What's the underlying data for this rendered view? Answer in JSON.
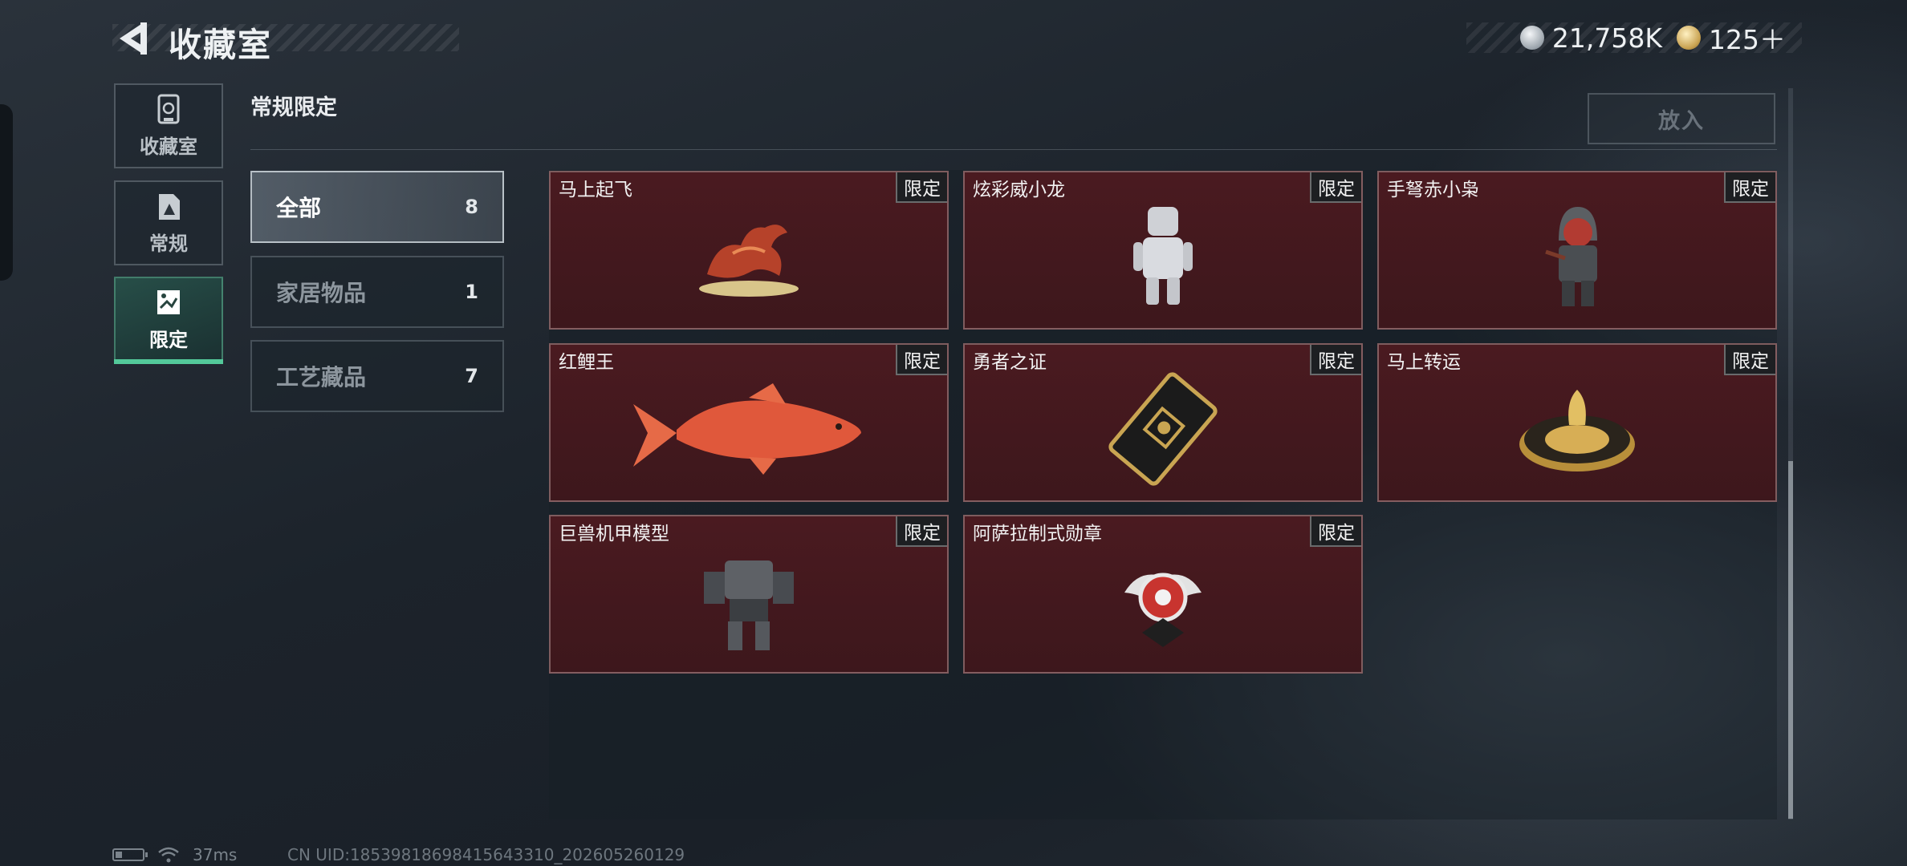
{
  "header": {
    "title": "收藏室",
    "currency_silver": "21,758K",
    "currency_gold": "125＋"
  },
  "sidebar": {
    "items": [
      {
        "label": "收藏室",
        "icon": "trophy-case-icon"
      },
      {
        "label": "常规",
        "icon": "document-icon"
      },
      {
        "label": "限定",
        "icon": "limited-picture-icon"
      }
    ],
    "active_index": 2
  },
  "section": {
    "title": "常规限定",
    "place_button": "放入"
  },
  "filters": [
    {
      "label": "全部",
      "count": "8"
    },
    {
      "label": "家居物品",
      "count": "1"
    },
    {
      "label": "工艺藏品",
      "count": "7"
    }
  ],
  "items": [
    {
      "name": "马上起飞",
      "tag": "限定",
      "icon": "horse-statue-icon"
    },
    {
      "name": "炫彩威小龙",
      "tag": "限定",
      "icon": "toy-figure-icon"
    },
    {
      "name": "手弩赤小枭",
      "tag": "限定",
      "icon": "hooded-figure-icon"
    },
    {
      "name": "红鲤王",
      "tag": "限定",
      "icon": "red-carp-icon"
    },
    {
      "name": "勇者之证",
      "tag": "限定",
      "icon": "card-emblem-icon"
    },
    {
      "name": "马上转运",
      "tag": "限定",
      "icon": "golden-wheel-icon"
    },
    {
      "name": "巨兽机甲模型",
      "tag": "限定",
      "icon": "mech-model-icon"
    },
    {
      "name": "阿萨拉制式勋章",
      "tag": "限定",
      "icon": "medal-icon"
    }
  ],
  "status": {
    "ping": "37ms",
    "uid": "CN UID:18539818698415643310_202605260129"
  },
  "colors": {
    "accent": "#53c99a",
    "card_bg": "#4a1a20"
  }
}
